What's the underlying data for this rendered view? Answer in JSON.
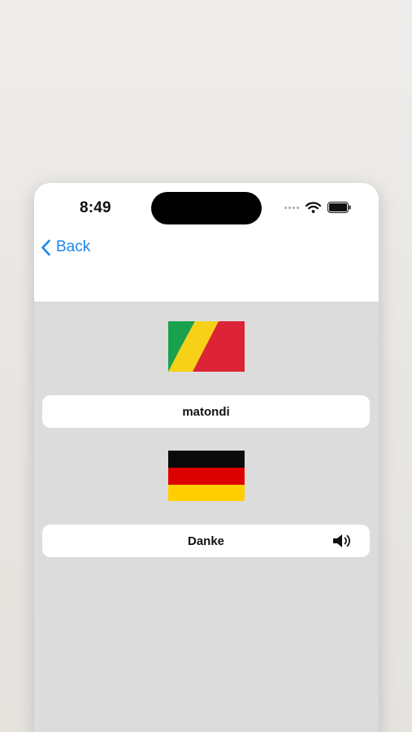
{
  "status_bar": {
    "time": "8:49"
  },
  "nav": {
    "back_label": "Back",
    "accent_color": "#1f86e6"
  },
  "translation": {
    "source": {
      "flag": "republic-of-the-congo-flag",
      "word": "matondi"
    },
    "target": {
      "flag": "germany-flag",
      "word": "Danke",
      "audio_icon": "speaker-icon"
    }
  }
}
